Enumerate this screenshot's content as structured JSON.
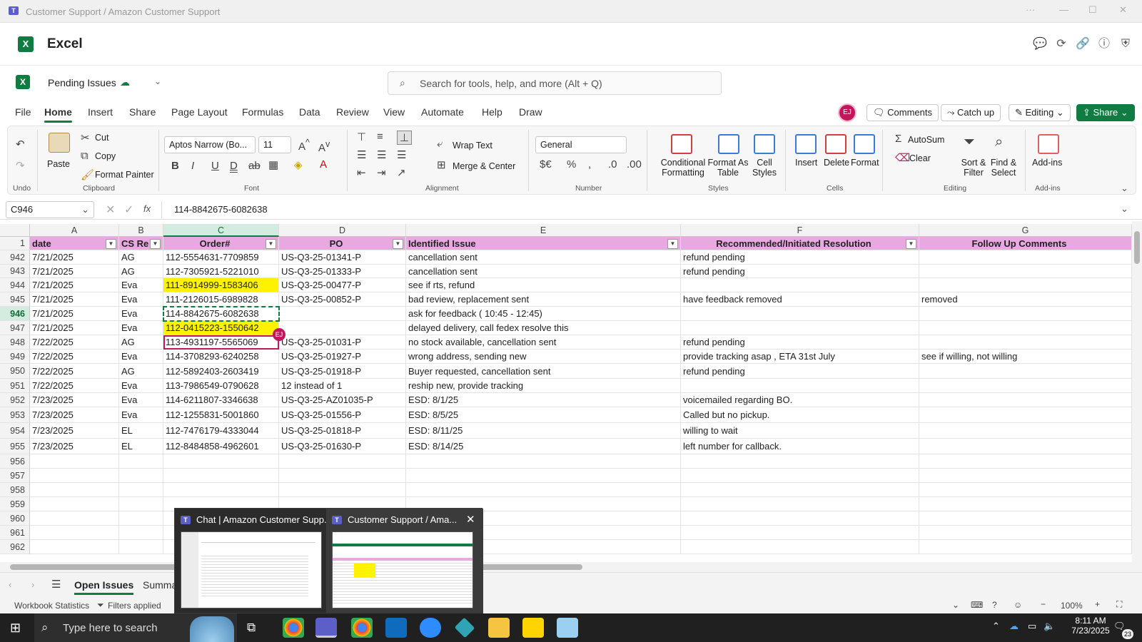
{
  "titlebar": {
    "title": "Customer Support / Amazon Customer Support",
    "more": "···"
  },
  "app": {
    "name": "Excel"
  },
  "document": {
    "name": "Pending Issues"
  },
  "search": {
    "placeholder": "Search for tools, help, and more (Alt + Q)"
  },
  "user": {
    "initials": "EJ"
  },
  "tabs": [
    "File",
    "Home",
    "Insert",
    "Share",
    "Page Layout",
    "Formulas",
    "Data",
    "Review",
    "View",
    "Automate",
    "Help",
    "Draw"
  ],
  "header_buttons": {
    "comments": "Comments",
    "catchup": "Catch up",
    "editing": "Editing",
    "share": "Share"
  },
  "ribbon": {
    "undo_group": "Undo",
    "paste": "Paste",
    "cut": "Cut",
    "copy": "Copy",
    "format_painter": "Format Painter",
    "clipboard_group": "Clipboard",
    "font_name": "Aptos Narrow (Bo...",
    "font_size": "11",
    "font_group": "Font",
    "wrap_text": "Wrap Text",
    "merge_center": "Merge & Center",
    "alignment_group": "Alignment",
    "number_format": "General",
    "number_group": "Number",
    "conditional_formatting": [
      "Conditional",
      "Formatting"
    ],
    "format_as_table": [
      "Format As",
      "Table"
    ],
    "cell_styles": [
      "Cell",
      "Styles"
    ],
    "styles_group": "Styles",
    "insert": "Insert",
    "delete": "Delete",
    "format": "Format",
    "cells_group": "Cells",
    "autosum": "AutoSum",
    "clear": "Clear",
    "sort_filter": [
      "Sort &",
      "Filter"
    ],
    "find_select": [
      "Find &",
      "Select"
    ],
    "editing_group": "Editing",
    "addins": "Add-ins",
    "addins_group": "Add-ins"
  },
  "formula_bar": {
    "name_box": "C946",
    "fx": "fx",
    "value": "114-8842675-6082638"
  },
  "columns": [
    "A",
    "B",
    "C",
    "D",
    "E",
    "F",
    "G"
  ],
  "header_row": {
    "num": "1",
    "cells": [
      "date",
      "CS Re",
      "Order#",
      "PO",
      "Identified Issue",
      "Recommended/Initiated Resolution",
      "Follow Up Comments"
    ]
  },
  "rows": [
    {
      "num": "942",
      "cells": [
        "7/21/2025",
        "AG",
        "112-5554631-7709859",
        "US-Q3-25-01341-P",
        "cancellation sent",
        "refund pending",
        ""
      ]
    },
    {
      "num": "943",
      "cells": [
        "7/21/2025",
        "AG",
        "112-7305921-5221010",
        "US-Q3-25-01333-P",
        "cancellation sent",
        "refund pending",
        ""
      ]
    },
    {
      "num": "944",
      "cells": [
        "7/21/2025",
        "Eva",
        "111-8914999-1583406",
        "US-Q3-25-00477-P",
        "see if rts, refund",
        "",
        ""
      ]
    },
    {
      "num": "945",
      "cells": [
        "7/21/2025",
        "Eva",
        "111-2126015-6989828",
        "US-Q3-25-00852-P",
        "bad review, replacement sent",
        "have feedback removed",
        "removed"
      ]
    },
    {
      "num": "946",
      "cells": [
        "7/21/2025",
        "Eva",
        "114-8842675-6082638",
        "",
        "ask for feedback ( 10:45 - 12:45)",
        "",
        ""
      ]
    },
    {
      "num": "947",
      "cells": [
        "7/21/2025",
        "Eva",
        "112-0415223-1550642",
        "",
        "delayed delivery, call fedex resolve this",
        "",
        ""
      ]
    },
    {
      "num": "948",
      "cells": [
        "7/22/2025",
        "AG",
        "113-4931197-5565069",
        "US-Q3-25-01031-P",
        "no stock available, cancellation sent",
        "refund pending",
        ""
      ]
    },
    {
      "num": "949",
      "cells": [
        "7/22/2025",
        "Eva",
        "114-3708293-6240258",
        "US-Q3-25-01927-P",
        "wrong address, sending new",
        "provide tracking asap , ETA 31st July",
        "see if willing, not willing"
      ]
    },
    {
      "num": "950",
      "cells": [
        "7/22/2025",
        "AG",
        "112-5892403-2603419",
        "US-Q3-25-01918-P",
        "Buyer requested, cancellation sent",
        "refund pending",
        ""
      ]
    },
    {
      "num": "951",
      "cells": [
        "7/22/2025",
        "Eva",
        "113-7986549-0790628",
        "12 instead of 1",
        "reship new, provide tracking",
        "",
        ""
      ]
    },
    {
      "num": "952",
      "cells": [
        "7/23/2025",
        "Eva",
        "114-6211807-3346638",
        "US-Q3-25-AZ01035-P",
        " ESD: 8/1/25",
        "voicemailed regarding BO.",
        ""
      ]
    },
    {
      "num": "953",
      "cells": [
        "7/23/2025",
        "Eva",
        "112-1255831-5001860",
        "US-Q3-25-01556-P",
        " ESD:  8/5/25",
        "Called but no pickup.",
        ""
      ]
    },
    {
      "num": "954",
      "cells": [
        "7/23/2025",
        "EL",
        "112-7476179-4333044",
        "US-Q3-25-01818-P",
        "ESD: 8/11/25",
        "willing to wait",
        ""
      ]
    },
    {
      "num": "955",
      "cells": [
        "7/23/2025",
        "EL",
        "112-8484858-4962601",
        "US-Q3-25-01630-P",
        "  ESD: 8/14/25",
        "left number for callback.",
        ""
      ]
    },
    {
      "num": "956",
      "cells": [
        "",
        "",
        "",
        "",
        "",
        "",
        ""
      ]
    },
    {
      "num": "957",
      "cells": [
        "",
        "",
        "",
        "",
        "",
        "",
        ""
      ]
    },
    {
      "num": "958",
      "cells": [
        "",
        "",
        "",
        "",
        "",
        "",
        ""
      ]
    },
    {
      "num": "959",
      "cells": [
        "",
        "",
        "",
        "",
        "",
        "",
        ""
      ]
    },
    {
      "num": "960",
      "cells": [
        "",
        "",
        "",
        "",
        "",
        "",
        ""
      ]
    },
    {
      "num": "961",
      "cells": [
        "",
        "",
        "",
        "",
        "",
        "",
        ""
      ]
    },
    {
      "num": "962",
      "cells": [
        "",
        "",
        "",
        "",
        "",
        "",
        ""
      ]
    }
  ],
  "selected_cell": "C946",
  "presence": {
    "initials": "EJ"
  },
  "sheets": {
    "active": "Open Issues",
    "other": "Summa"
  },
  "status": {
    "workbook_stats": "Workbook Statistics",
    "filters": "Filters applied",
    "zoom": "100%"
  },
  "taskbar": {
    "search_placeholder": "Type here to search",
    "time": "8:11 AM",
    "date": "7/23/2025",
    "notif_count": "23"
  },
  "preview": {
    "items": [
      {
        "title": "Chat | Amazon Customer Supp..."
      },
      {
        "title": "Customer Support / Ama..."
      }
    ]
  },
  "colors": {
    "excel_green": "#107c41",
    "header_pink": "#e8a8e0",
    "highlight_yellow": "#fff200",
    "presence_pink": "#c2185b"
  }
}
